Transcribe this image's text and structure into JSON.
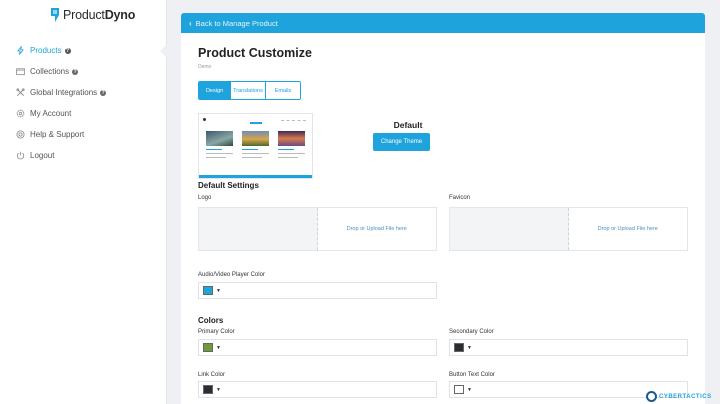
{
  "brand": {
    "name_part1": "Product",
    "name_part2": "Dyno"
  },
  "sidebar": {
    "items": [
      {
        "label": "Products",
        "icon": "bolt-icon",
        "active": true,
        "help": true
      },
      {
        "label": "Collections",
        "icon": "folder-icon",
        "active": false,
        "help": true
      },
      {
        "label": "Global Integrations",
        "icon": "tools-icon",
        "active": false,
        "help": true
      },
      {
        "label": "My Account",
        "icon": "gear-icon",
        "active": false,
        "help": false
      },
      {
        "label": "Help & Support",
        "icon": "lifebuoy-icon",
        "active": false,
        "help": false
      },
      {
        "label": "Logout",
        "icon": "power-icon",
        "active": false,
        "help": false
      }
    ]
  },
  "header": {
    "back_label": "Back to Manage Product"
  },
  "page": {
    "title": "Product Customize",
    "subtitle": "Demo"
  },
  "tabs": [
    {
      "label": "Design",
      "active": true
    },
    {
      "label": "Translations",
      "active": false
    },
    {
      "label": "Emails",
      "active": false
    }
  ],
  "theme": {
    "name": "Default",
    "change_button": "Change Theme"
  },
  "default_settings": {
    "heading": "Default Settings",
    "logo_label": "Logo",
    "logo_upload": "Drop or Upload File here",
    "favicon_label": "Favicon",
    "favicon_upload": "Drop or Upload File here",
    "player_color_label": "Audio/Video Player Color",
    "player_color": "#1ea3dc"
  },
  "colors": {
    "heading": "Colors",
    "primary_label": "Primary Color",
    "primary_color": "#6e9a3a",
    "secondary_label": "Secondary Color",
    "secondary_color": "#2a2d33",
    "link_label": "Link Color",
    "link_color": "#2a2d33",
    "button_text_label": "Button Text Color",
    "button_text_color": "#ffffff"
  },
  "watermark": {
    "text_a": "CYBER",
    "text_b": "TACTICS"
  }
}
